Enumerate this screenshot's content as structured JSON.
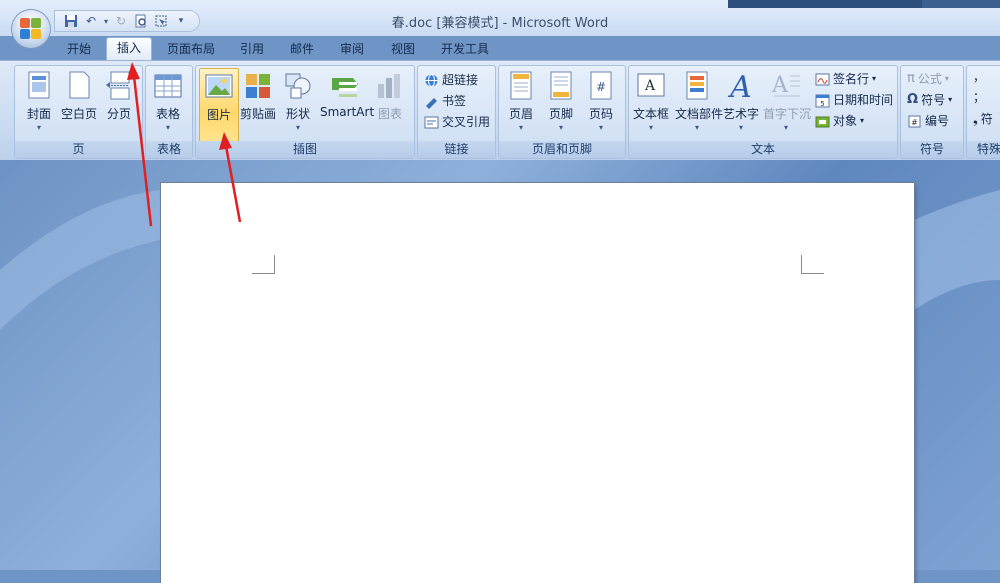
{
  "window": {
    "title": "春.doc [兼容模式] - Microsoft Word"
  },
  "tabs": [
    {
      "label": "开始"
    },
    {
      "label": "插入",
      "active": true
    },
    {
      "label": "页面布局"
    },
    {
      "label": "引用"
    },
    {
      "label": "邮件"
    },
    {
      "label": "审阅"
    },
    {
      "label": "视图"
    },
    {
      "label": "开发工具"
    }
  ],
  "ribbon": {
    "groups": {
      "pages": {
        "label": "页",
        "cover": "封面",
        "blank": "空白页",
        "break": "分页"
      },
      "tables": {
        "label": "表格",
        "table": "表格"
      },
      "illustrations": {
        "label": "插图",
        "picture": "图片",
        "clipart": "剪贴画",
        "shapes": "形状",
        "smartart": "SmartArt",
        "chart": "图表"
      },
      "links": {
        "label": "链接",
        "hyperlink": "超链接",
        "bookmark": "书签",
        "crossref": "交叉引用"
      },
      "header_footer": {
        "label": "页眉和页脚",
        "header": "页眉",
        "footer": "页脚",
        "pagenum": "页码"
      },
      "text": {
        "label": "文本",
        "textbox": "文本框",
        "quickparts": "文档部件",
        "wordart": "艺术字",
        "dropcap": "首字下沉",
        "signature": "签名行",
        "datetime": "日期和时间",
        "object": "对象"
      },
      "symbols": {
        "label": "符号",
        "equation": "公式",
        "symbol": "符号",
        "number": "编号"
      },
      "special": {
        "label": "特殊",
        "item": "符"
      }
    }
  },
  "colors": {
    "accent": "#ffd86b",
    "arrow": "#e02020"
  }
}
